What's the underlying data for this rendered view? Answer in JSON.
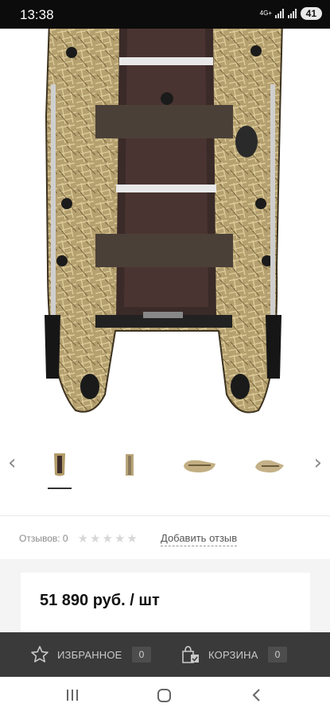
{
  "status_bar": {
    "time": "13:38",
    "network": "4G+",
    "battery": "41"
  },
  "product": {
    "image_icon": "inflatable-boat-photo"
  },
  "gallery": {
    "prev_icon": "chevron-left-icon",
    "next_icon": "chevron-right-icon",
    "thumbnails": [
      "boat-top-view",
      "boat-side-view",
      "boat-angle-view-1",
      "boat-angle-view-2"
    ],
    "active_index": 0
  },
  "reviews": {
    "count_label": "Отзывов: 0",
    "rating": 0,
    "max_rating": 5,
    "add_review_label": "Добавить отзыв"
  },
  "price": {
    "text": "51 890 руб. / шт"
  },
  "action_bar": {
    "favorites_label": "ИЗБРАННОЕ",
    "favorites_count": "0",
    "cart_label": "КОРЗИНА",
    "cart_count": "0"
  },
  "colors": {
    "action_bar_bg": "#3a3a3a",
    "status_bar_bg": "#0c0c0c",
    "accent_text": "#111111"
  }
}
